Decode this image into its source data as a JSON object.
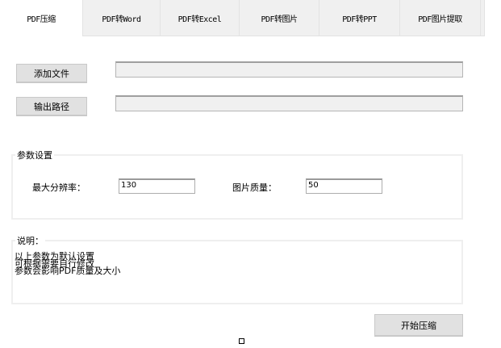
{
  "tabs": [
    {
      "label": "PDF压缩"
    },
    {
      "label": "PDF转Word"
    },
    {
      "label": "PDF转Excel"
    },
    {
      "label": "PDF转图片"
    },
    {
      "label": "PDF转PPT"
    },
    {
      "label": "PDF图片提取"
    }
  ],
  "file": {
    "add_label": "添加文件",
    "add_value": "",
    "output_label": "输出路径",
    "output_value": ""
  },
  "params": {
    "title": "参数设置",
    "max_res_label": "最大分辨率：",
    "max_res_value": "130",
    "quality_label": "图片质量：",
    "quality_value": "50"
  },
  "notes": {
    "title": "说明：",
    "lines": [
      "以上参数为默认设置",
      "可根据需要自行修改",
      "参数会影响PDF质量及大小"
    ]
  },
  "start_label": "开始压缩"
}
